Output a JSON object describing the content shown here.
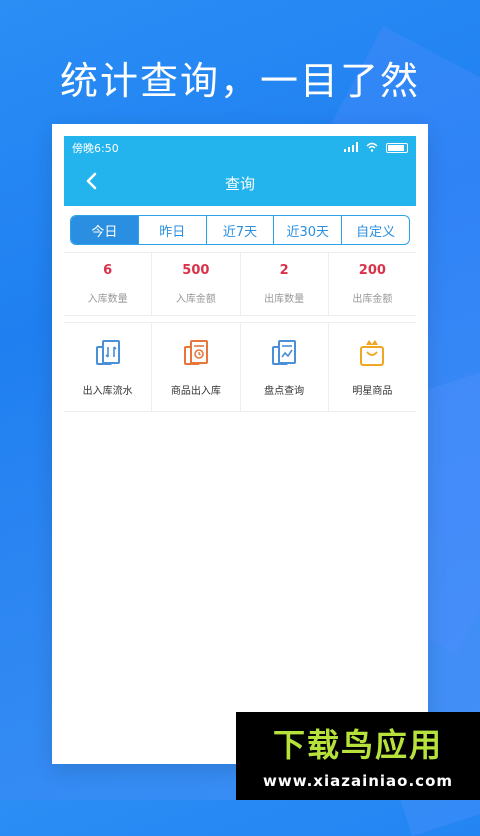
{
  "headline": "统计查询，一目了然",
  "status_bar": {
    "time": "傍晚6:50"
  },
  "nav": {
    "title": "查询",
    "back_icon": "chevron-left-icon"
  },
  "segments": [
    {
      "label": "今日",
      "active": true
    },
    {
      "label": "昨日",
      "active": false
    },
    {
      "label": "近7天",
      "active": false
    },
    {
      "label": "近30天",
      "active": false
    },
    {
      "label": "自定义",
      "active": false
    }
  ],
  "stats": [
    {
      "value": "6",
      "label": "入库数量"
    },
    {
      "value": "500",
      "label": "入库金额"
    },
    {
      "value": "2",
      "label": "出库数量"
    },
    {
      "value": "200",
      "label": "出库金额"
    }
  ],
  "functions": [
    {
      "label": "出入库流水",
      "icon": "in-out-ledger-icon"
    },
    {
      "label": "商品出入库",
      "icon": "goods-in-out-icon"
    },
    {
      "label": "盘点查询",
      "icon": "inventory-check-icon"
    },
    {
      "label": "明星商品",
      "icon": "star-product-icon"
    }
  ],
  "colors": {
    "primary": "#23b4ee",
    "segment_active": "#2a8fe0",
    "stat_value": "#d9324a",
    "watermark_green": "#b7e23b"
  },
  "watermark": {
    "title": "下载鸟应用",
    "url": "www.xiazainiao.com"
  }
}
